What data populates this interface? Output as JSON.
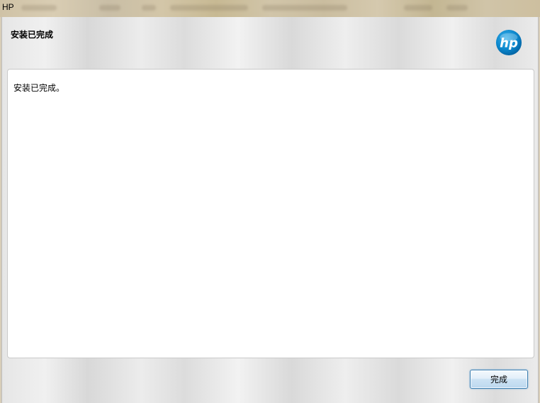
{
  "window": {
    "title": "HP"
  },
  "header": {
    "title": "安装已完成"
  },
  "logo": {
    "text": "hp",
    "brand_color": "#0096d6"
  },
  "content": {
    "message": "安装已完成。"
  },
  "footer": {
    "finish_label": "完成"
  }
}
